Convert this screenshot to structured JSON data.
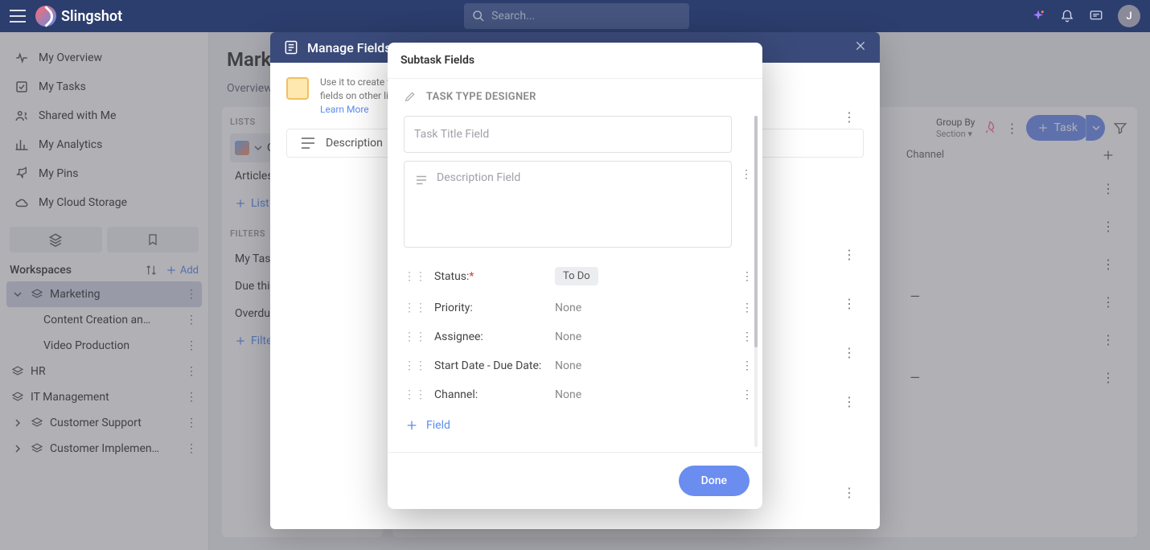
{
  "app": {
    "name": "Slingshot"
  },
  "search": {
    "placeholder": "Search..."
  },
  "avatar": {
    "initial": "J"
  },
  "nav": {
    "overview": "My Overview",
    "tasks": "My Tasks",
    "shared": "Shared with Me",
    "analytics": "My Analytics",
    "pins": "My Pins",
    "cloud": "My Cloud Storage"
  },
  "workspaces": {
    "title": "Workspaces",
    "add": "Add",
    "items": [
      {
        "name": "Marketing",
        "active": true
      },
      {
        "name": "HR"
      },
      {
        "name": "IT Management"
      },
      {
        "name": "Customer Support"
      },
      {
        "name": "Customer Implementa…"
      }
    ],
    "marketing_children": [
      "Content Creation an…",
      "Video Production"
    ]
  },
  "page": {
    "title": "Marke",
    "tabs": [
      "Overview"
    ]
  },
  "left_col": {
    "lists_label": "LISTS",
    "lists": [
      {
        "name": "Campaign",
        "active": true,
        "abbrev": "Campaign"
      },
      {
        "name": "Articles"
      }
    ],
    "add_list": "List",
    "filters_label": "FILTERS",
    "filters": [
      "My Task",
      "Due this",
      "Overdue"
    ],
    "add_filter": "Filte"
  },
  "right_col": {
    "group_by_label": "Group By",
    "group_by_value": "Section",
    "task_btn": "Task",
    "channel_header": "Channel"
  },
  "manage_fields": {
    "title": "Manage Fields",
    "info": "Use it to create t\nfields on other lis",
    "learn_more": "Learn More",
    "desc_label": "Description"
  },
  "subtask_modal": {
    "title": "Subtask Fields",
    "designer": "TASK TYPE DESIGNER",
    "task_title_placeholder": "Task Title Field",
    "description_placeholder": "Description Field",
    "fields": [
      {
        "label": "Status:",
        "required": true,
        "value": "To Do",
        "chip": true
      },
      {
        "label": "Priority:",
        "value": "None"
      },
      {
        "label": "Assignee:",
        "value": "None"
      },
      {
        "label": "Start Date - Due Date:",
        "value": "None"
      },
      {
        "label": "Channel:",
        "value": "None"
      }
    ],
    "add_field": "Field",
    "done": "Done"
  }
}
